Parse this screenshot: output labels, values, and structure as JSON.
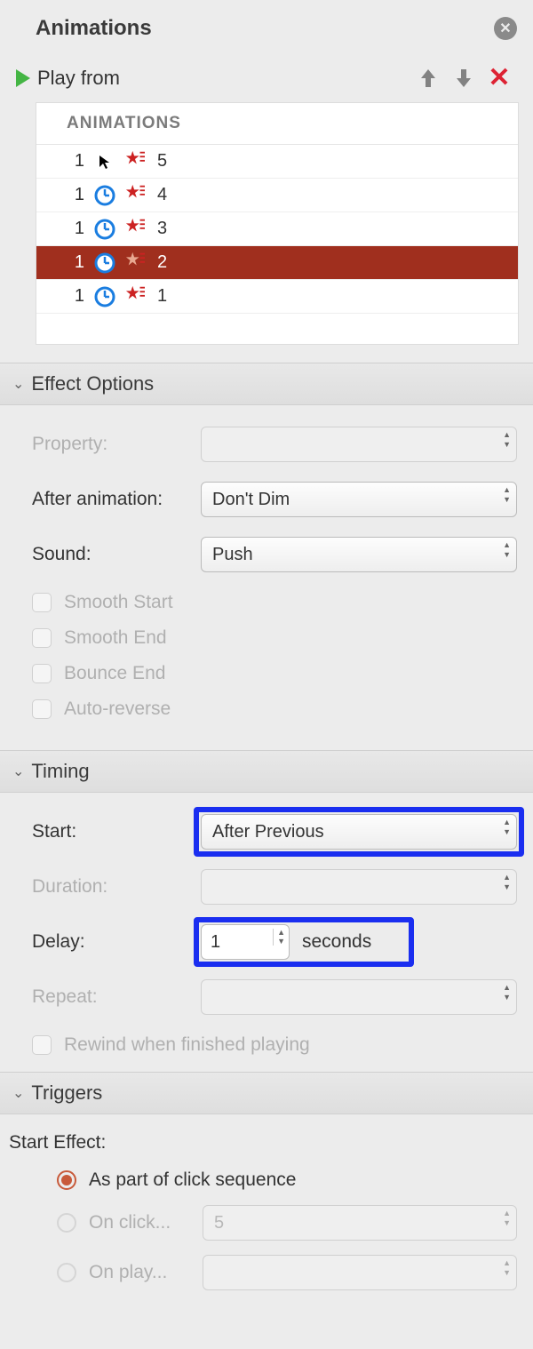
{
  "header": {
    "title": "Animations"
  },
  "toolbar": {
    "play_label": "Play from"
  },
  "list": {
    "header": "ANIMATIONS",
    "items": [
      {
        "order": "1",
        "trigger": "cursor",
        "label": "5",
        "selected": false
      },
      {
        "order": "1",
        "trigger": "clock",
        "label": "4",
        "selected": false
      },
      {
        "order": "1",
        "trigger": "clock",
        "label": "3",
        "selected": false
      },
      {
        "order": "1",
        "trigger": "clock",
        "label": "2",
        "selected": true
      },
      {
        "order": "1",
        "trigger": "clock",
        "label": "1",
        "selected": false
      }
    ]
  },
  "sections": {
    "effect_options": "Effect Options",
    "timing": "Timing",
    "triggers": "Triggers"
  },
  "effect": {
    "property_label": "Property:",
    "after_anim_label": "After animation:",
    "after_anim_value": "Don't Dim",
    "sound_label": "Sound:",
    "sound_value": "Push",
    "smooth_start": "Smooth Start",
    "smooth_end": "Smooth End",
    "bounce_end": "Bounce End",
    "auto_reverse": "Auto-reverse"
  },
  "timing": {
    "start_label": "Start:",
    "start_value": "After Previous",
    "duration_label": "Duration:",
    "delay_label": "Delay:",
    "delay_value": "1",
    "delay_unit": "seconds",
    "repeat_label": "Repeat:",
    "rewind_label": "Rewind when finished playing"
  },
  "triggers": {
    "start_effect_label": "Start Effect:",
    "opt1": "As part of click sequence",
    "opt2": "On click...",
    "opt2_value": "5",
    "opt3": "On play..."
  }
}
